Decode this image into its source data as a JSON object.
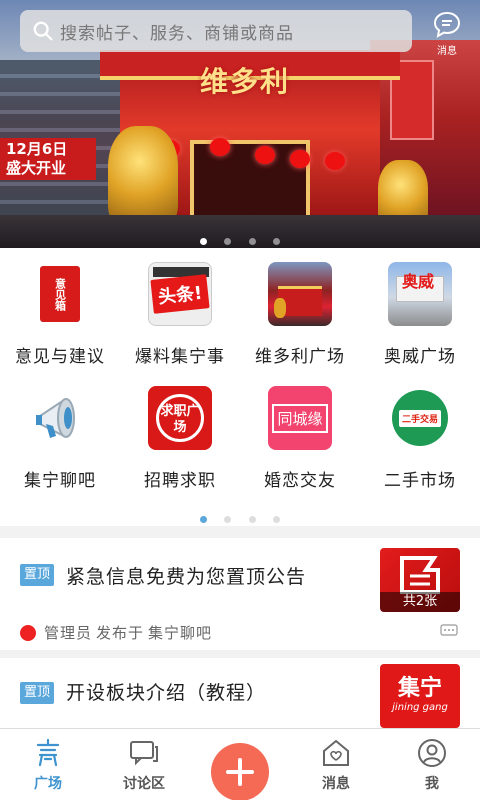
{
  "header": {
    "search_placeholder": "搜索帖子、服务、商铺或商品",
    "messages_label": "消息"
  },
  "banner": {
    "sign_text_line1": "12月6日",
    "sign_text_line2": "盛大开业",
    "storefront_text": "维多利",
    "slides": 4,
    "active_slide": 1
  },
  "grid": {
    "items": [
      {
        "label": "意见与建议",
        "icon": "suggestion-box-icon",
        "icon_text": "意见箱"
      },
      {
        "label": "爆料集宁事",
        "icon": "headlines-icon",
        "icon_text": "头条!"
      },
      {
        "label": "维多利广场",
        "icon": "victoria-plaza-icon",
        "icon_text": ""
      },
      {
        "label": "奥威广场",
        "icon": "aowei-plaza-icon",
        "icon_text": "奥威"
      },
      {
        "label": "集宁聊吧",
        "icon": "megaphone-icon",
        "icon_text": ""
      },
      {
        "label": "招聘求职",
        "icon": "job-icon",
        "icon_text": "求职广场"
      },
      {
        "label": "婚恋交友",
        "icon": "matchmaking-icon",
        "icon_text": "同城缘"
      },
      {
        "label": "二手市场",
        "icon": "secondhand-icon",
        "icon_text": "二手交易"
      }
    ],
    "pages": 4,
    "active_page": 1
  },
  "posts": [
    {
      "tag": "置顶",
      "title": "紧急信息免费为您置顶公告",
      "thumb_count": "共2张",
      "author": "管理员",
      "action": "发布于",
      "board": "集宁聊吧"
    },
    {
      "tag": "置顶",
      "title": "开设板块介绍（教程）",
      "thumb_text": "集宁",
      "thumb_sub": "jining gang"
    }
  ],
  "tabbar": {
    "items": [
      {
        "label": "广场",
        "icon": "plaza-icon",
        "active": true
      },
      {
        "label": "讨论区",
        "icon": "discussion-icon",
        "active": false
      },
      {
        "label": "",
        "icon": "plus-icon",
        "active": false
      },
      {
        "label": "消息",
        "icon": "home-message-icon",
        "active": false
      },
      {
        "label": "我",
        "icon": "profile-icon",
        "active": false
      }
    ]
  },
  "colors": {
    "accent": "#3f93cf",
    "tag": "#5aa7dc",
    "plus": "#f46a55"
  }
}
